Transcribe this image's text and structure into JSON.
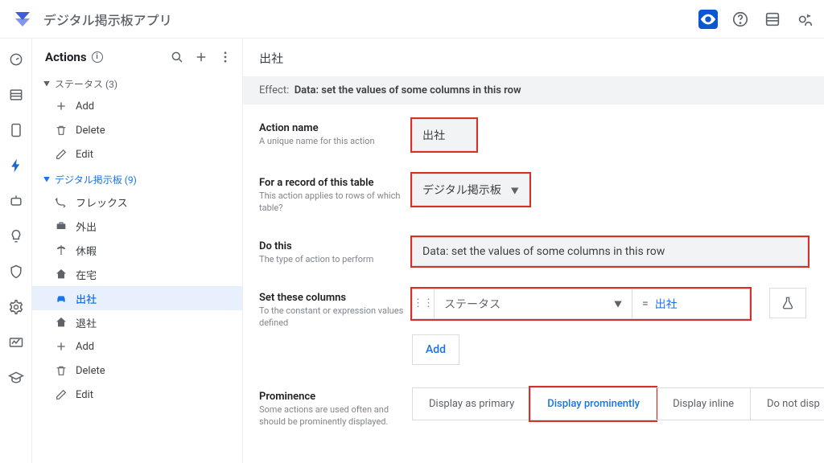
{
  "app_title": "デジタル掲示板アプリ",
  "sidebar": {
    "title": "Actions",
    "groups": [
      {
        "label": "ステータス (3)",
        "style": "muted",
        "items": [
          {
            "icon": "plus",
            "label": "Add"
          },
          {
            "icon": "trash",
            "label": "Delete"
          },
          {
            "icon": "edit",
            "label": "Edit"
          }
        ]
      },
      {
        "label": "デジタル掲示板 (9)",
        "style": "link",
        "items": [
          {
            "icon": "history",
            "label": "フレックス"
          },
          {
            "icon": "briefcase",
            "label": "外出"
          },
          {
            "icon": "beach",
            "label": "休暇"
          },
          {
            "icon": "home",
            "label": "在宅"
          },
          {
            "icon": "car",
            "label": "出社",
            "selected": true
          },
          {
            "icon": "home",
            "label": "退社"
          },
          {
            "icon": "plus",
            "label": "Add"
          },
          {
            "icon": "trash",
            "label": "Delete"
          },
          {
            "icon": "edit",
            "label": "Edit"
          }
        ]
      }
    ]
  },
  "main": {
    "title": "出社",
    "effect_prefix": "Effect:",
    "effect_value": "Data: set the values of some columns in this row",
    "fields": {
      "action_name": {
        "label": "Action name",
        "desc": "A unique name for this action",
        "value": "出社"
      },
      "table": {
        "label": "For a record of this table",
        "desc": "This action applies to rows of which table?",
        "value": "デジタル掲示板"
      },
      "do_this": {
        "label": "Do this",
        "desc": "The type of action to perform",
        "value": "Data: set the values of some columns in this row"
      },
      "set_columns": {
        "label": "Set these columns",
        "desc": "To the constant or expression values defined",
        "column_name": "ステータス",
        "column_value_prefix": "=",
        "column_value": "出社",
        "add_label": "Add"
      },
      "prominence": {
        "label": "Prominence",
        "desc": "Some actions are used often and should be prominently displayed.",
        "options": [
          "Display as primary",
          "Display prominently",
          "Display inline",
          "Do not disp"
        ],
        "active_index": 1
      }
    }
  }
}
